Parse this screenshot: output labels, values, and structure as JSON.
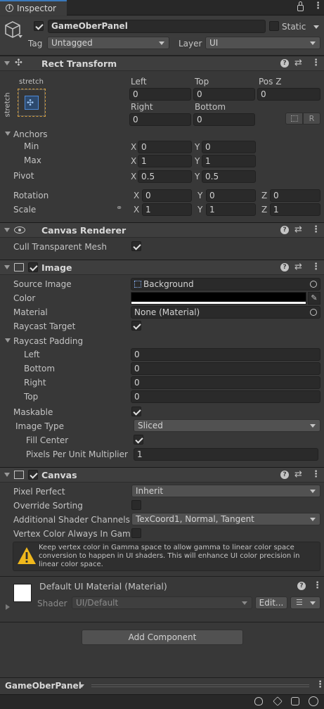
{
  "tab": {
    "label": "Inspector"
  },
  "object": {
    "name": "GameOberPanel",
    "static_label": "Static",
    "tag_label": "Tag",
    "tag_value": "Untagged",
    "layer_label": "Layer",
    "layer_value": "UI"
  },
  "rect_transform": {
    "title": "Rect Transform",
    "anchor_preset_h": "stretch",
    "anchor_preset_v": "stretch",
    "labels": {
      "left": "Left",
      "top": "Top",
      "posz": "Pos Z",
      "right": "Right",
      "bottom": "Bottom"
    },
    "values": {
      "left": "0",
      "top": "0",
      "posz": "0",
      "right": "0",
      "bottom": "0"
    },
    "r_button": "R",
    "anchors_label": "Anchors",
    "min_label": "Min",
    "max_label": "Max",
    "pivot_label": "Pivot",
    "min": {
      "x": "0",
      "y": "0"
    },
    "max": {
      "x": "1",
      "y": "1"
    },
    "pivot": {
      "x": "0.5",
      "y": "0.5"
    },
    "rotation_label": "Rotation",
    "scale_label": "Scale",
    "rotation": {
      "x": "0",
      "y": "0",
      "z": "0"
    },
    "scale": {
      "x": "1",
      "y": "1",
      "z": "1"
    },
    "axis": {
      "x": "X",
      "y": "Y",
      "z": "Z"
    }
  },
  "canvas_renderer": {
    "title": "Canvas Renderer",
    "cull_label": "Cull Transparent Mesh",
    "cull": true
  },
  "image": {
    "title": "Image",
    "source_image_label": "Source Image",
    "source_image": "Background",
    "color_label": "Color",
    "color_value": "#000000",
    "material_label": "Material",
    "material": "None (Material)",
    "raycast_target_label": "Raycast Target",
    "raycast_padding_label": "Raycast Padding",
    "padding": [
      {
        "label": "Left",
        "value": "0"
      },
      {
        "label": "Bottom",
        "value": "0"
      },
      {
        "label": "Right",
        "value": "0"
      },
      {
        "label": "Top",
        "value": "0"
      }
    ],
    "maskable_label": "Maskable",
    "image_type_label": "Image Type",
    "image_type": "Sliced",
    "fill_center_label": "Fill Center",
    "ppu_label": "Pixels Per Unit Multiplier",
    "ppu": "1"
  },
  "canvas": {
    "title": "Canvas",
    "pixel_perfect_label": "Pixel Perfect",
    "pixel_perfect": "Inherit",
    "override_sorting_label": "Override Sorting",
    "shader_channels_label": "Additional Shader Channels",
    "shader_channels": "TexCoord1, Normal, Tangent",
    "vertex_color_label": "Vertex Color Always In Gam",
    "warning": "Keep vertex color in Gamma space to allow gamma to linear color space conversion to happen in UI shaders. This will enhance UI color precision in linear color space."
  },
  "material": {
    "title": "Default UI Material (Material)",
    "shader_label": "Shader",
    "shader": "UI/Default",
    "edit_button": "Edit..."
  },
  "add_component": "Add Component",
  "footer": {
    "object_name": "GameOberPanel"
  },
  "colors": {
    "panel": "#383838",
    "header": "#3e3e3e",
    "field": "#2a2a2a",
    "accent": "#4d8ad8"
  }
}
